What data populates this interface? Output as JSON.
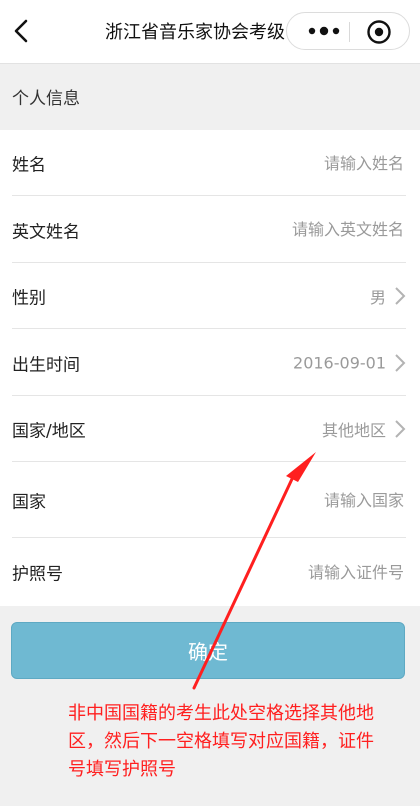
{
  "navbar": {
    "title": "浙江省音乐家协会考级",
    "icons": {
      "back": "back-chevron-icon",
      "more": "more-dots-icon",
      "close": "target-close-icon"
    }
  },
  "section": {
    "title": "个人信息"
  },
  "form": {
    "name": {
      "label": "姓名",
      "placeholder": "请输入姓名"
    },
    "english_name": {
      "label": "英文姓名",
      "placeholder": "请输入英文姓名"
    },
    "gender": {
      "label": "性别",
      "value": "男"
    },
    "birth_date": {
      "label": "出生时间",
      "value": "2016-09-01"
    },
    "region": {
      "label": "国家/地区",
      "value": "其他地区"
    },
    "country": {
      "label": "国家",
      "placeholder": "请输入国家"
    },
    "passport": {
      "label": "护照号",
      "placeholder": "请输入证件号"
    }
  },
  "confirm_button": {
    "label": "确定"
  },
  "annotation": {
    "text": "非中国国籍的考生此处空格选择其他地区，然后下一空格填写对应国籍，证件号填写护照号",
    "color": "#ff1f1f"
  },
  "colors": {
    "button": "#6fb9d2",
    "placeholder": "#9a9a9a"
  }
}
